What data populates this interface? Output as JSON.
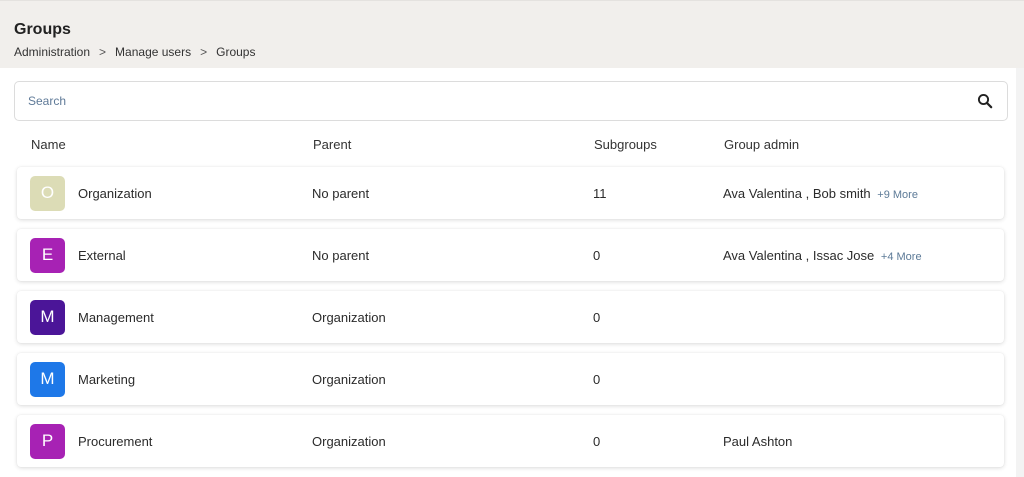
{
  "header": {
    "title": "Groups",
    "breadcrumb": [
      "Administration",
      "Manage users",
      "Groups"
    ],
    "separator": ">"
  },
  "search": {
    "placeholder": "Search",
    "value": "",
    "icon": "search-icon"
  },
  "columns": {
    "name": "Name",
    "parent": "Parent",
    "subgroups": "Subgroups",
    "admin": "Group admin"
  },
  "rows": [
    {
      "initial": "O",
      "name": "Organization",
      "parent": "No parent",
      "subgroups": "11",
      "admin": "Ava Valentina , Bob smith",
      "more": "+9 More",
      "color": "#dcdcb6"
    },
    {
      "initial": "E",
      "name": "External",
      "parent": "No parent",
      "subgroups": "0",
      "admin": "Ava Valentina , Issac Jose",
      "more": "+4 More",
      "color": "#a722b4"
    },
    {
      "initial": "M",
      "name": "Management",
      "parent": "Organization",
      "subgroups": "0",
      "admin": "",
      "more": "",
      "color": "#4b1598"
    },
    {
      "initial": "M",
      "name": "Marketing",
      "parent": "Organization",
      "subgroups": "0",
      "admin": "",
      "more": "",
      "color": "#1e78e8"
    },
    {
      "initial": "P",
      "name": "Procurement",
      "parent": "Organization",
      "subgroups": "0",
      "admin": "Paul Ashton",
      "more": "",
      "color": "#a722b4"
    }
  ]
}
